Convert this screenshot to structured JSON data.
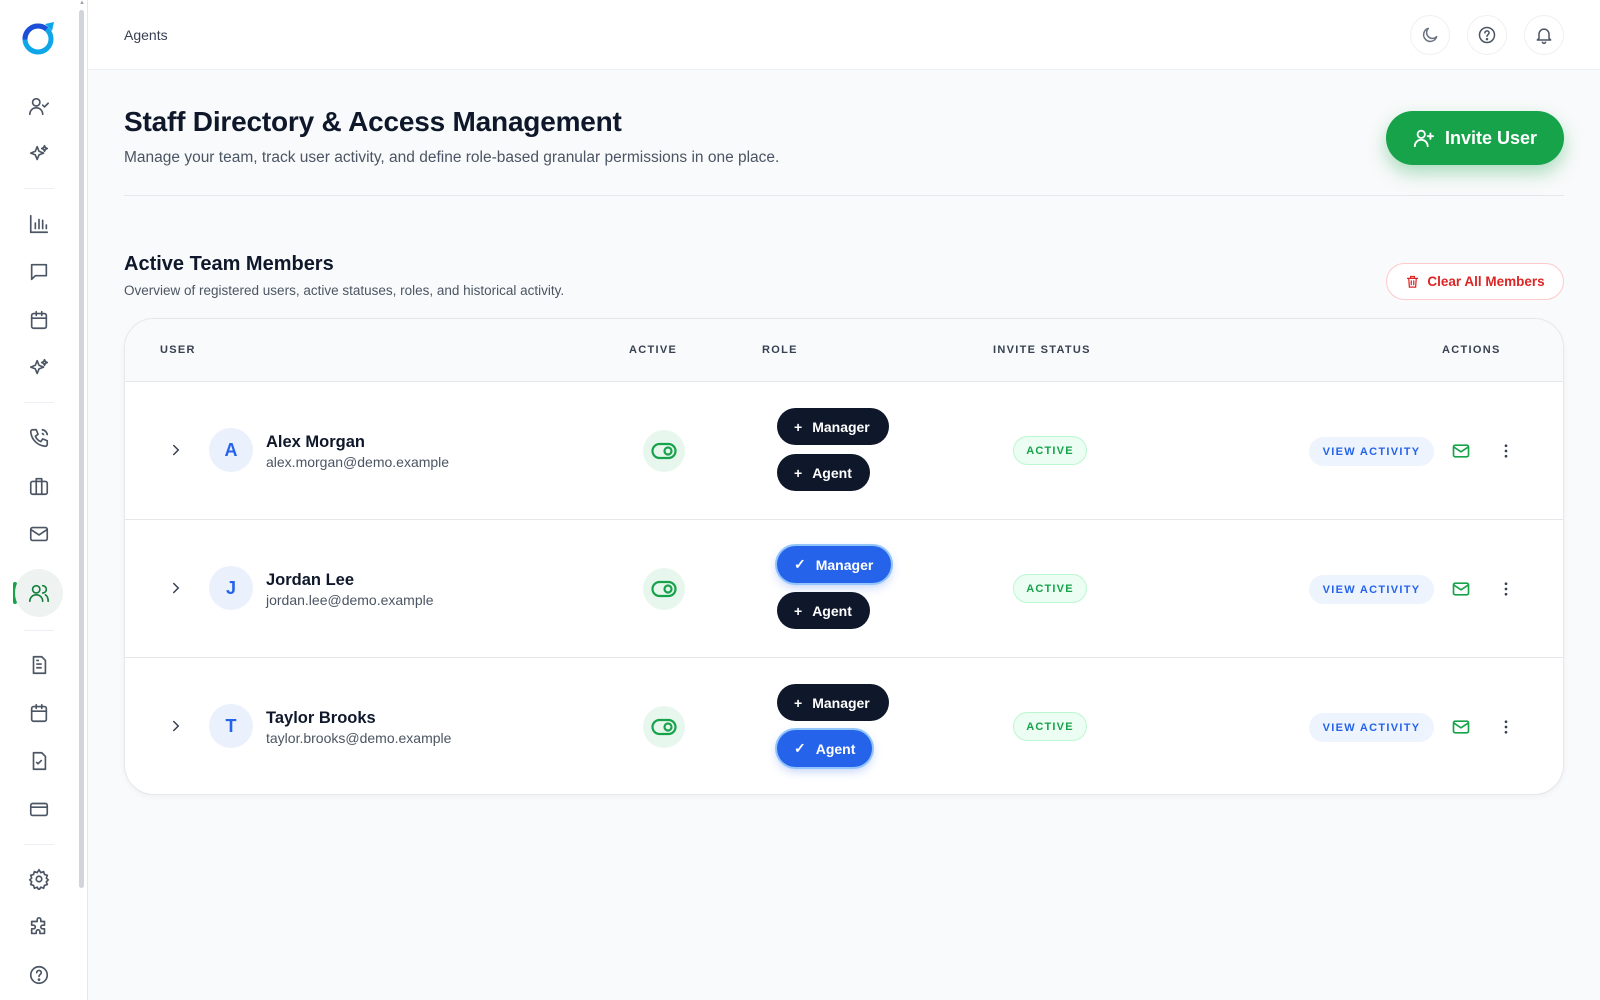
{
  "breadcrumb": "Agents",
  "header": {
    "title": "Staff Directory & Access Management",
    "subtitle": "Manage your team, track user activity, and define role-based granular permissions in one place.",
    "invite_label": "Invite User"
  },
  "section": {
    "title": "Active Team Members",
    "subtitle": "Overview of registered users, active statuses, roles, and historical activity.",
    "clear_label": "Clear All Members"
  },
  "table": {
    "columns": [
      "USER",
      "ACTIVE",
      "ROLE",
      "INVITE STATUS",
      "ACTIONS"
    ],
    "rows": [
      {
        "initial": "A",
        "name": "Alex Morgan",
        "email": "alex.morgan@demo.example",
        "active": true,
        "roles": [
          {
            "label": "Manager",
            "selected": false,
            "glyph": "+"
          },
          {
            "label": "Agent",
            "selected": false,
            "glyph": "+"
          }
        ],
        "status": "ACTIVE",
        "view_label": "VIEW ACTIVITY"
      },
      {
        "initial": "J",
        "name": "Jordan Lee",
        "email": "jordan.lee@demo.example",
        "active": true,
        "roles": [
          {
            "label": "Manager",
            "selected": true,
            "glyph": "✓"
          },
          {
            "label": "Agent",
            "selected": false,
            "glyph": "+"
          }
        ],
        "status": "ACTIVE",
        "view_label": "VIEW ACTIVITY"
      },
      {
        "initial": "T",
        "name": "Taylor Brooks",
        "email": "taylor.brooks@demo.example",
        "active": true,
        "roles": [
          {
            "label": "Manager",
            "selected": false,
            "glyph": "+"
          },
          {
            "label": "Agent",
            "selected": true,
            "glyph": "✓"
          }
        ],
        "status": "ACTIVE",
        "view_label": "VIEW ACTIVITY"
      }
    ]
  },
  "colors": {
    "primary_green": "#16a34a",
    "role_selected": "#2563eb",
    "role_unselected": "#0f172a",
    "danger": "#dc2626"
  },
  "icons": {
    "sidebar": [
      "user-check-icon",
      "sparkles-icon",
      "bar-chart-icon",
      "message-icon",
      "calendar-icon",
      "sparkles-icon",
      "phone-icon",
      "briefcase-icon",
      "mail-icon",
      "users-icon",
      "document-icon",
      "calendar-icon",
      "clipboard-check-icon",
      "credit-card-icon",
      "settings-icon",
      "puzzle-icon",
      "help-icon"
    ],
    "top": [
      "moon-icon",
      "help-icon",
      "bell-icon"
    ]
  }
}
